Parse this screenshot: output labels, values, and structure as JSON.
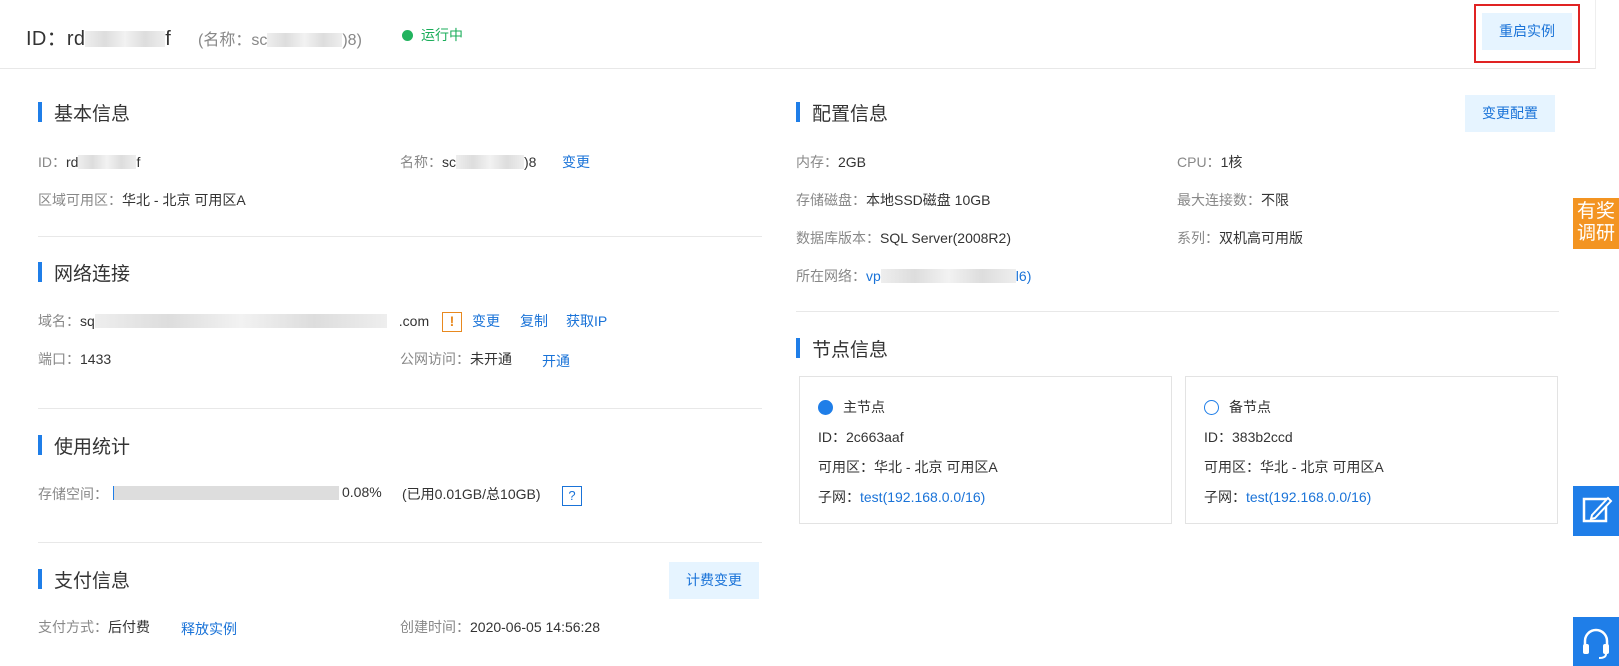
{
  "header": {
    "id_prefix": "ID：rd",
    "id_suffix": "f",
    "name_prefix": "(名称：sc",
    "name_suffix": ")8)",
    "status": "运行中",
    "restart_button": "重启实例"
  },
  "basic": {
    "title": "基本信息",
    "id_label": "ID：",
    "id_prefix": "rd",
    "id_suffix": "f",
    "name_label": "名称：",
    "name_prefix": "sc",
    "name_suffix": ")8",
    "name_change": "变更",
    "zone_label": "区域可用区：",
    "zone_value": "华北 - 北京 可用区A"
  },
  "network": {
    "title": "网络连接",
    "domain_label": "域名：",
    "domain_prefix": "sq",
    "domain_suffix": ".com",
    "warn_icon": "!",
    "change": "变更",
    "copy": "复制",
    "get_ip": "获取IP",
    "port_label": "端口：",
    "port_value": "1433",
    "public_label": "公网访问：",
    "public_value": "未开通",
    "open_link": "开通"
  },
  "usage": {
    "title": "使用统计",
    "storage_label": "存储空间：",
    "storage_fraction": 0.0008,
    "percent": "0.08%",
    "detail": "(已用0.01GB/总10GB)",
    "help_icon": "?"
  },
  "payment": {
    "title": "支付信息",
    "change_billing": "计费变更",
    "method_label": "支付方式：",
    "method_value": "后付费",
    "release_link": "释放实例",
    "created_label": "创建时间：",
    "created_value": "2020-06-05 14:56:28"
  },
  "config": {
    "title": "配置信息",
    "change_button": "变更配置",
    "memory_label": "内存：",
    "memory_value": "2GB",
    "cpu_label": "CPU：",
    "cpu_value": "1核",
    "disk_label": "存储磁盘：",
    "disk_value": "本地SSD磁盘 10GB",
    "maxconn_label": "最大连接数：",
    "maxconn_value": "不限",
    "dbver_label": "数据库版本：",
    "dbver_value": "SQL Server(2008R2)",
    "series_label": "系列：",
    "series_value": "双机高可用版",
    "network_label": "所在网络：",
    "network_prefix": "vp",
    "network_suffix": "l6)"
  },
  "nodes": {
    "title": "节点信息",
    "primary": {
      "title": "主节点",
      "id": "ID：2c663aaf",
      "zone": "可用区：华北 - 北京 可用区A",
      "subnet_label": "子网：",
      "subnet_link": "test(192.168.0.0/16)"
    },
    "standby": {
      "title": "备节点",
      "id": "ID：383b2ccd",
      "zone": "可用区：华北 - 北京 可用区A",
      "subnet_label": "子网：",
      "subnet_link": "test(192.168.0.0/16)"
    }
  },
  "sidebar": {
    "survey_line1": "有奖",
    "survey_line2": "调研",
    "edit_icon": "edit-icon",
    "support_icon": "headset-icon"
  },
  "colors": {
    "accent": "#1f7ee8",
    "running": "#22b35e",
    "warning": "#e8891f",
    "highlight_box": "#e02323",
    "survey": "#f39421"
  }
}
